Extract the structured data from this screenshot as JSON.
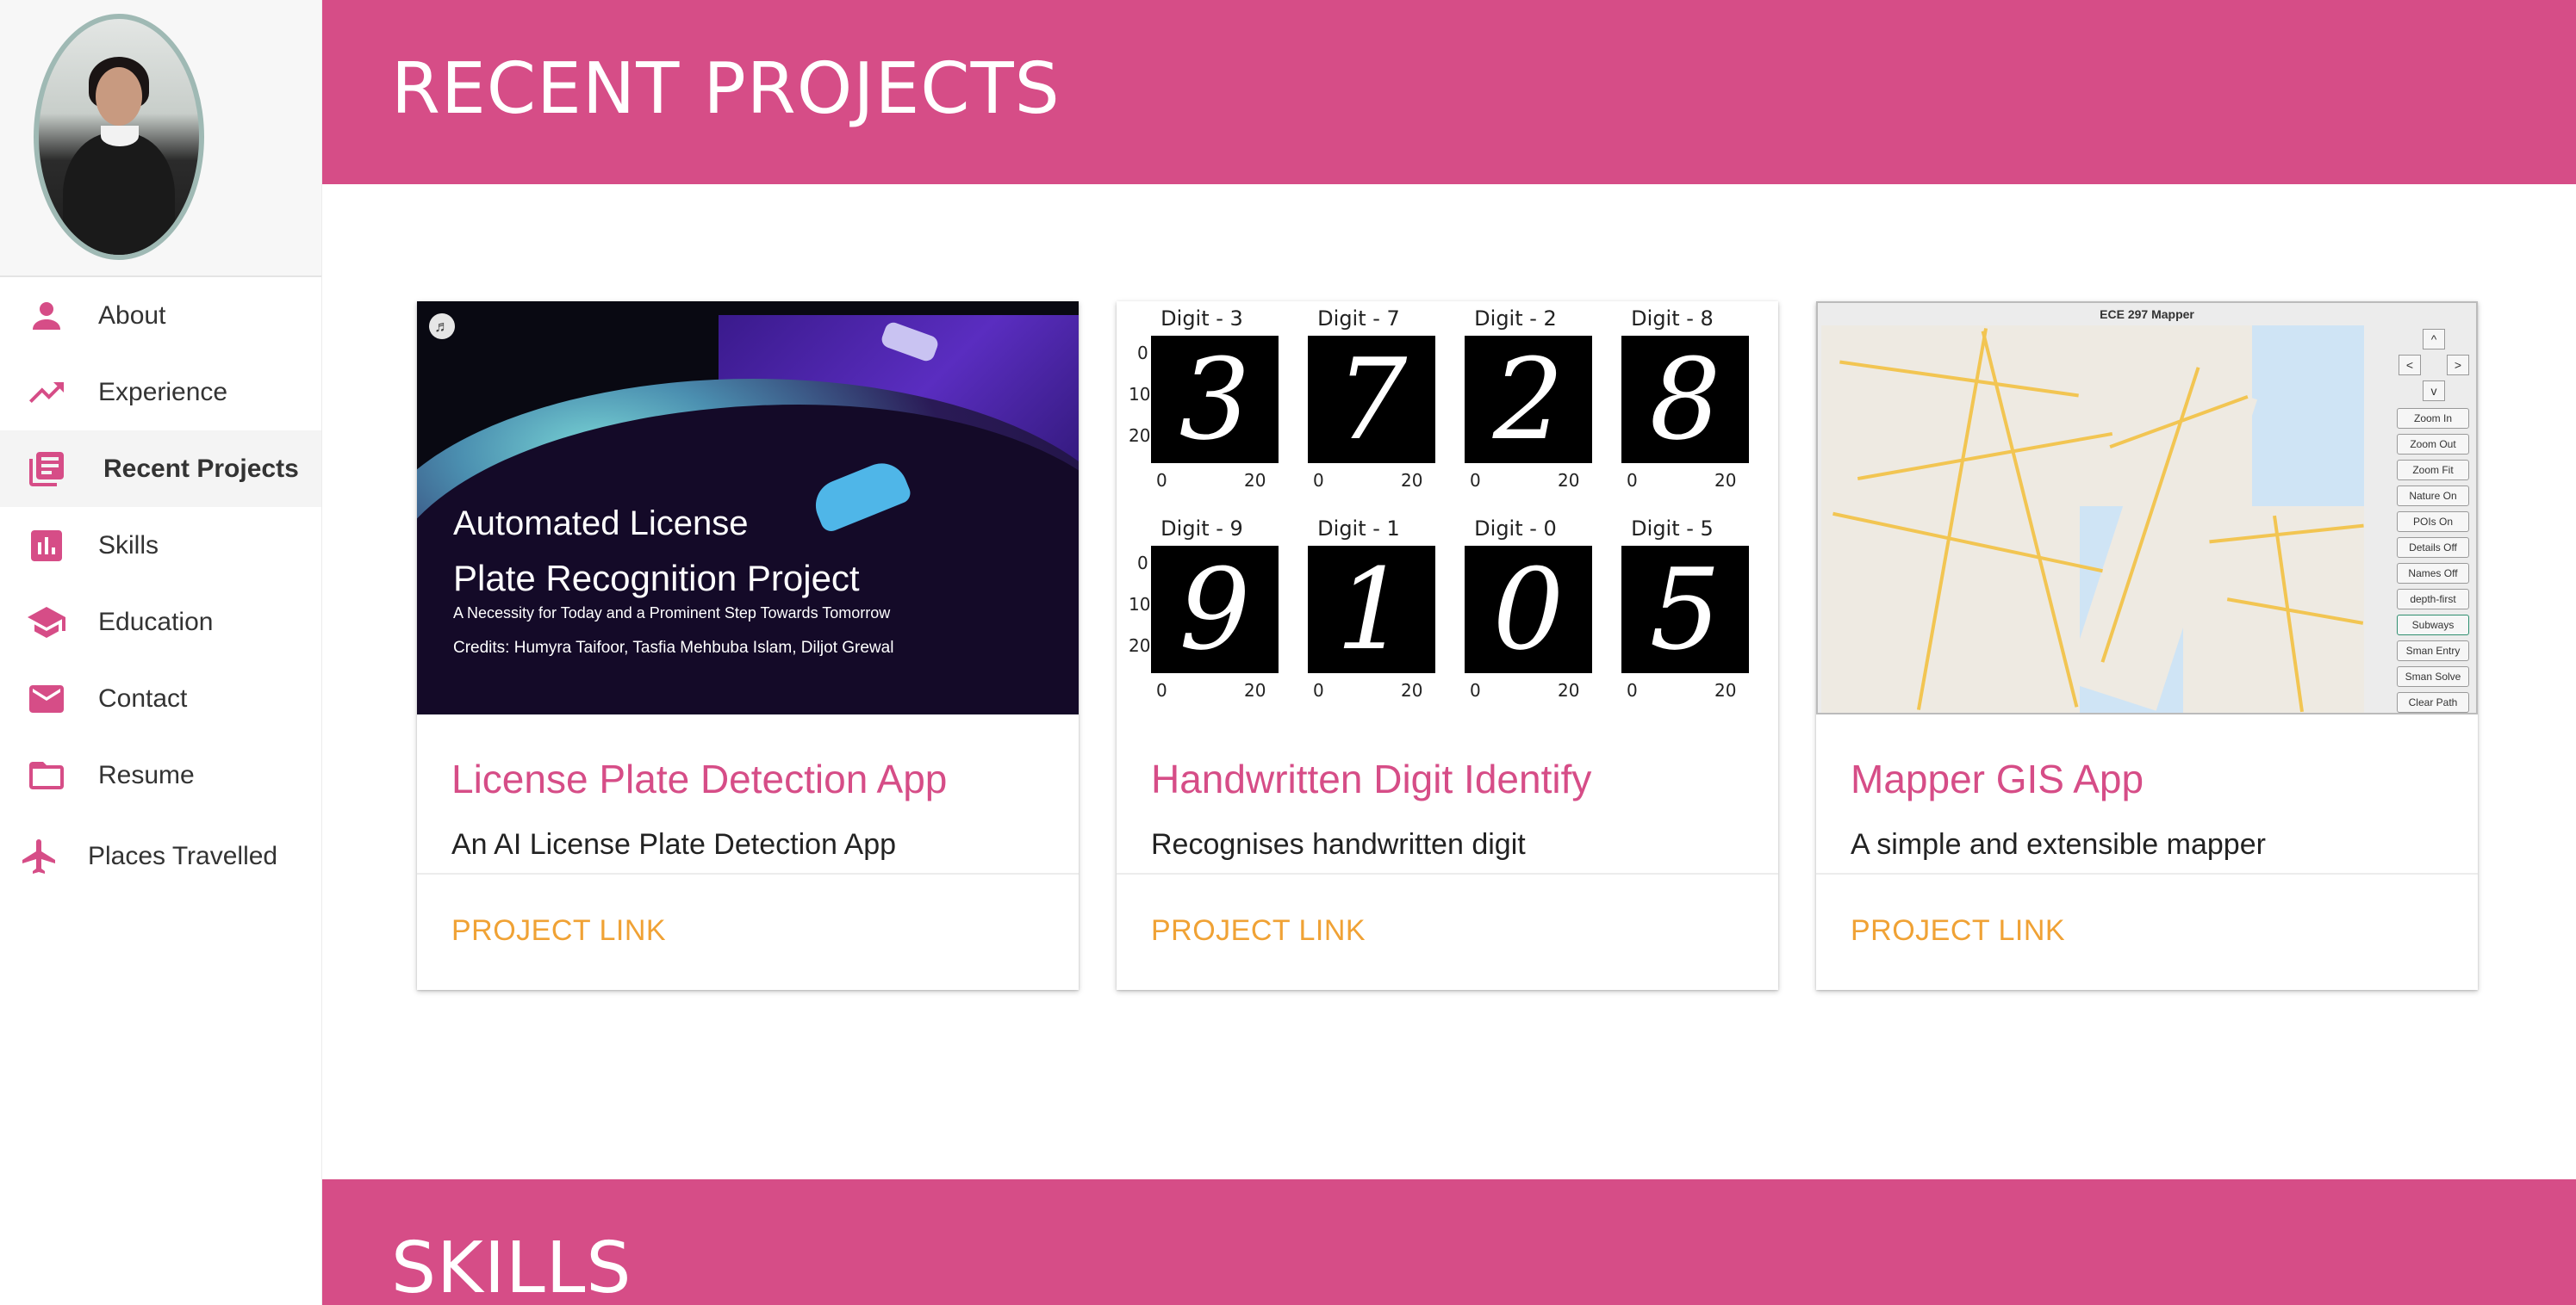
{
  "sidebar": {
    "items": [
      {
        "label": "About",
        "icon": "person-icon"
      },
      {
        "label": "Experience",
        "icon": "trending-up-icon"
      },
      {
        "label": "Recent Projects",
        "icon": "library-books-icon"
      },
      {
        "label": "Skills",
        "icon": "bar-chart-icon"
      },
      {
        "label": "Education",
        "icon": "school-icon"
      },
      {
        "label": "Contact",
        "icon": "mail-icon"
      },
      {
        "label": "Resume",
        "icon": "folder-icon"
      },
      {
        "label": "Places Travelled",
        "icon": "airplane-icon"
      }
    ],
    "active_index": 2
  },
  "sections": {
    "recent_projects_title": "RECENT PROJECTS",
    "skills_title": "SKILLS"
  },
  "projects": [
    {
      "title": "License Plate Detection App",
      "description": "An AI License Plate Detection App",
      "link_label": "PROJECT LINK",
      "poster": {
        "line1": "Automated License",
        "line2": "Plate Recognition Project",
        "subtitle": "A Necessity for Today and a Prominent Step Towards Tomorrow",
        "credits": "Credits: Humyra Taifoor, Tasfia Mehbuba Islam, Diljot Grewal"
      }
    },
    {
      "title": "Handwritten Digit Identify",
      "description": "Recognises handwritten digit",
      "link_label": "PROJECT LINK",
      "digits": [
        {
          "label": "Digit - 3",
          "glyph": "3"
        },
        {
          "label": "Digit - 7",
          "glyph": "7"
        },
        {
          "label": "Digit - 2",
          "glyph": "2"
        },
        {
          "label": "Digit - 8",
          "glyph": "8"
        },
        {
          "label": "Digit - 9",
          "glyph": "9"
        },
        {
          "label": "Digit - 1",
          "glyph": "1"
        },
        {
          "label": "Digit - 0",
          "glyph": "0"
        },
        {
          "label": "Digit - 5",
          "glyph": "5"
        }
      ],
      "y_ticks": [
        "0",
        "10",
        "20"
      ],
      "x_ticks": [
        "0",
        "20"
      ]
    },
    {
      "title": "Mapper GIS App",
      "description": "A simple and extensible mapper",
      "link_label": "PROJECT LINK",
      "window_title": "ECE 297 Mapper",
      "arrows": [
        "^",
        "<",
        ">",
        "v"
      ],
      "buttons": [
        "Zoom In",
        "Zoom Out",
        "Zoom Fit",
        "Nature On",
        "POIs On",
        "Details Off",
        "Names Off",
        "depth-first",
        "Subways",
        "Sman Entry",
        "Sman Solve",
        "Clear Path"
      ],
      "selected_button": "Subways"
    }
  ],
  "colors": {
    "brand": "#d64d87",
    "link": "#f0a235",
    "text": "#333333"
  }
}
